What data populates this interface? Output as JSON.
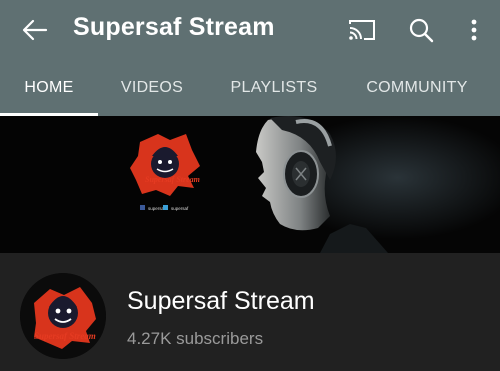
{
  "header": {
    "title": "Supersaf Stream",
    "icons": [
      "back-arrow-icon",
      "cast-icon",
      "search-icon",
      "more-vert-icon"
    ]
  },
  "tabs": [
    {
      "label": "HOME",
      "active": true
    },
    {
      "label": "VIDEOS",
      "active": false
    },
    {
      "label": "PLAYLISTS",
      "active": false
    },
    {
      "label": "COMMUNITY",
      "active": false
    }
  ],
  "banner": {
    "logo_text": "Supersaf Stream",
    "social": [
      "supersaf",
      "supersaf"
    ]
  },
  "channel": {
    "name": "Supersaf Stream",
    "subscribers": "4.27K subscribers",
    "avatar_text": "Supersaf Stream"
  },
  "colors": {
    "appbar": "#5f7072",
    "background": "#212121",
    "logo_red": "#d8341c"
  }
}
